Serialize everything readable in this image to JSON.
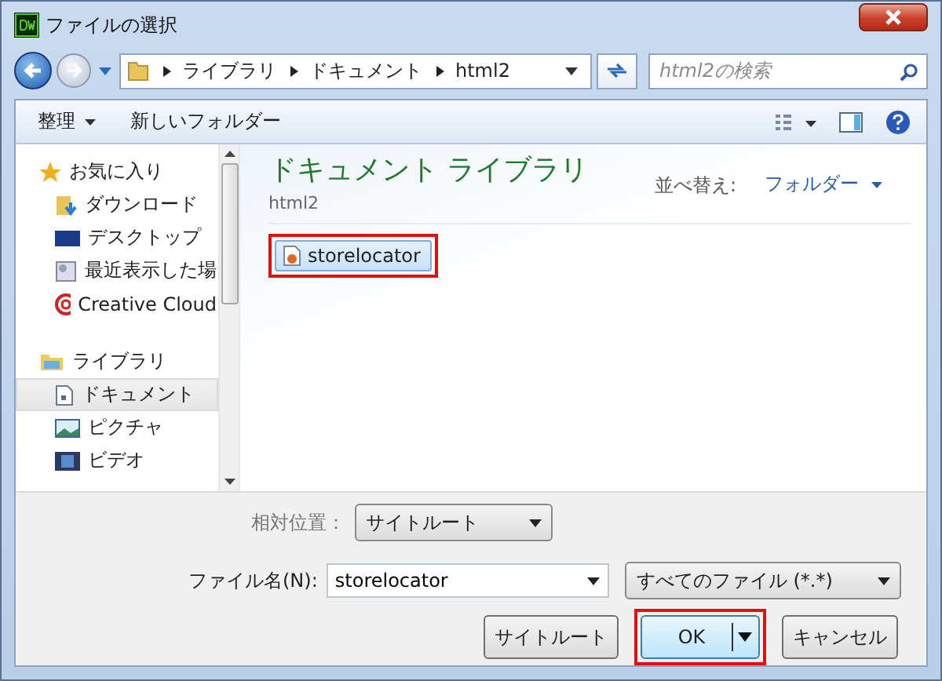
{
  "window": {
    "title": "ファイルの選択"
  },
  "address": {
    "path": [
      {
        "label": "ライブラリ"
      },
      {
        "label": "ドキュメント"
      },
      {
        "label": "html2"
      }
    ]
  },
  "search": {
    "placeholder": "html2の検索"
  },
  "toolbar": {
    "organize": "整理",
    "new_folder": "新しいフォルダー"
  },
  "sidebar": {
    "items": [
      {
        "kind": "favorites",
        "label": "お気に入り",
        "selected": false
      },
      {
        "kind": "downloads",
        "label": "ダウンロード",
        "selected": false
      },
      {
        "kind": "desktop",
        "label": "デスクトップ",
        "selected": false
      },
      {
        "kind": "recent",
        "label": "最近表示した場",
        "selected": false
      },
      {
        "kind": "cloud",
        "label": "Creative Cloud",
        "selected": false
      },
      {
        "kind": "libraries",
        "label": "ライブラリ",
        "selected": false
      },
      {
        "kind": "documents",
        "label": "ドキュメント",
        "selected": true
      },
      {
        "kind": "pictures",
        "label": "ピクチャ",
        "selected": false
      },
      {
        "kind": "videos",
        "label": "ビデオ",
        "selected": false
      }
    ]
  },
  "content": {
    "title": "ドキュメント ライブラリ",
    "subtitle": "html2",
    "sort_label": "並べ替え:",
    "sort_value": "フォルダー",
    "files": [
      {
        "name": "storelocator",
        "selected": true,
        "highlighted": true
      }
    ]
  },
  "footer": {
    "relative_label": "相対位置：",
    "relative_value": "サイトルート",
    "filename_label": "ファイル名(N):",
    "filename_value": "storelocator",
    "filetype": "すべてのファイル (*.*)",
    "buttons": [
      {
        "kind": "plain",
        "label": "サイトルート",
        "highlighted": false
      },
      {
        "kind": "split",
        "label": "OK",
        "highlighted": true
      },
      {
        "kind": "plain",
        "label": "キャンセル",
        "highlighted": false
      }
    ]
  }
}
